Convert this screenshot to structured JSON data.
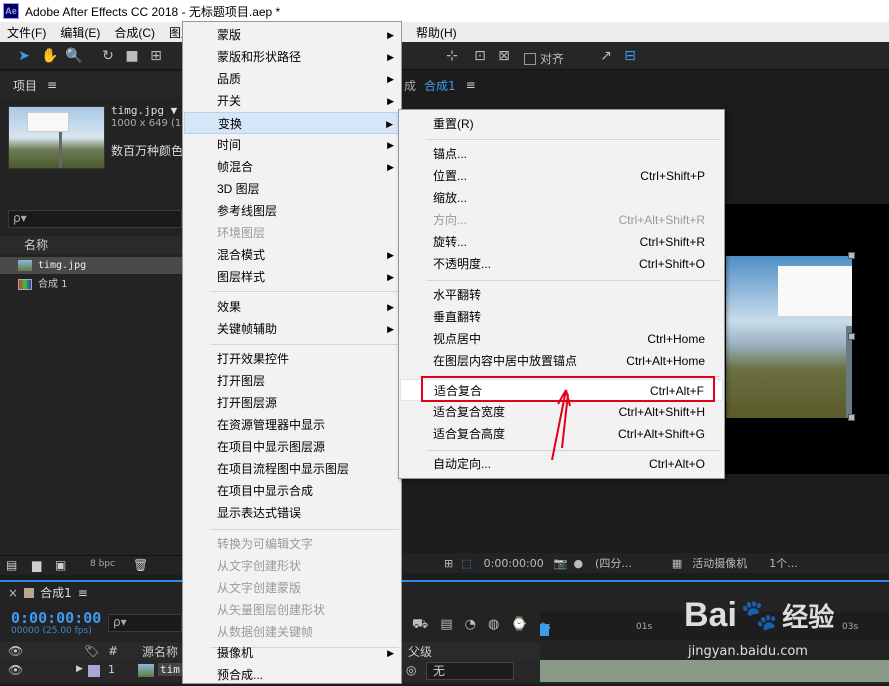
{
  "titlebar": {
    "icon": "Ae",
    "title": "Adobe After Effects CC 2018 - 无标题项目.aep *"
  },
  "menubar": {
    "items": [
      "文件(F)",
      "编辑(E)",
      "合成(C)",
      "图层",
      "帮助(H)"
    ]
  },
  "toolbar": {
    "align_label": "对齐"
  },
  "project": {
    "header": "项目",
    "file_name": "timg.jpg ▼",
    "file_size": "1000 x 649 (1",
    "file_desc": "数百万种颜色",
    "search_placeholder": "ρ▾",
    "col_name": "名称",
    "rows": [
      "timg.jpg",
      "合成 1"
    ],
    "bpc": "8 bpc"
  },
  "comp": {
    "tab_prefix": "成",
    "tab_name": "合成1",
    "time": "0:00:00:00",
    "quality": "(四分...",
    "camera": "活动摄像机",
    "views": "1个..."
  },
  "timeline": {
    "tab": "合成1",
    "time": "0:00:00:00",
    "fps": "00000 (25.00 fps)",
    "search_placeholder": "ρ▾",
    "col_source": "源名称",
    "col_parent": "父级",
    "row_index": "1",
    "row_name": "tim",
    "parent_value": "无",
    "ruler_ticks": [
      "0s",
      "01s",
      "03s"
    ]
  },
  "context_menu": {
    "items": [
      {
        "label": "蒙版",
        "sub": true
      },
      {
        "label": "蒙版和形状路径",
        "sub": true
      },
      {
        "label": "品质",
        "sub": true
      },
      {
        "label": "开关",
        "sub": true
      },
      {
        "label": "变换",
        "sub": true,
        "highlight": true
      },
      {
        "label": "时间",
        "sub": true
      },
      {
        "label": "帧混合",
        "sub": true
      },
      {
        "label": "3D 图层"
      },
      {
        "label": "参考线图层"
      },
      {
        "label": "环境图层",
        "disabled": true
      },
      {
        "label": "混合模式",
        "sub": true
      },
      {
        "label": "图层样式",
        "sub": true
      },
      {
        "label": "效果",
        "sub": true
      },
      {
        "label": "关键帧辅助",
        "sub": true
      },
      {
        "label": "打开效果控件"
      },
      {
        "label": "打开图层"
      },
      {
        "label": "打开图层源"
      },
      {
        "label": "在资源管理器中显示"
      },
      {
        "label": "在项目中显示图层源"
      },
      {
        "label": "在项目流程图中显示图层"
      },
      {
        "label": "在项目中显示合成"
      },
      {
        "label": "显示表达式错误"
      },
      {
        "label": "转换为可编辑文字",
        "disabled": true
      },
      {
        "label": "从文字创建形状",
        "disabled": true
      },
      {
        "label": "从文字创建蒙版",
        "disabled": true
      },
      {
        "label": "从矢量图层创建形状",
        "disabled": true
      },
      {
        "label": "从数据创建关键帧",
        "disabled": true
      },
      {
        "label": "摄像机",
        "sub": true
      },
      {
        "label": "预合成..."
      }
    ]
  },
  "transform_menu": {
    "items": [
      {
        "label": "重置(R)",
        "shortcut": ""
      },
      {
        "label": "锚点...",
        "shortcut": ""
      },
      {
        "label": "位置...",
        "shortcut": "Ctrl+Shift+P"
      },
      {
        "label": "缩放...",
        "shortcut": ""
      },
      {
        "label": "方向...",
        "shortcut": "Ctrl+Alt+Shift+R",
        "disabled": true
      },
      {
        "label": "旋转...",
        "shortcut": "Ctrl+Shift+R"
      },
      {
        "label": "不透明度...",
        "shortcut": "Ctrl+Shift+O"
      },
      {
        "label": "水平翻转",
        "shortcut": ""
      },
      {
        "label": "垂直翻转",
        "shortcut": ""
      },
      {
        "label": "视点居中",
        "shortcut": "Ctrl+Home"
      },
      {
        "label": "在图层内容中居中放置锚点",
        "shortcut": "Ctrl+Alt+Home"
      },
      {
        "label": "适合复合",
        "shortcut": "Ctrl+Alt+F",
        "highlight": true
      },
      {
        "label": "适合复合宽度",
        "shortcut": "Ctrl+Alt+Shift+H"
      },
      {
        "label": "适合复合高度",
        "shortcut": "Ctrl+Alt+Shift+G"
      },
      {
        "label": "自动定向...",
        "shortcut": "Ctrl+Alt+O"
      }
    ]
  },
  "watermark": {
    "brand": "Bai",
    "brand2": "经验",
    "url": "jingyan.baidu.com"
  },
  "colors": {
    "accent": "#2d8ceb",
    "annotation": "#e2001a",
    "menu_bg": "#f2f2f2",
    "menu_highlight": "#d6e6f7"
  }
}
